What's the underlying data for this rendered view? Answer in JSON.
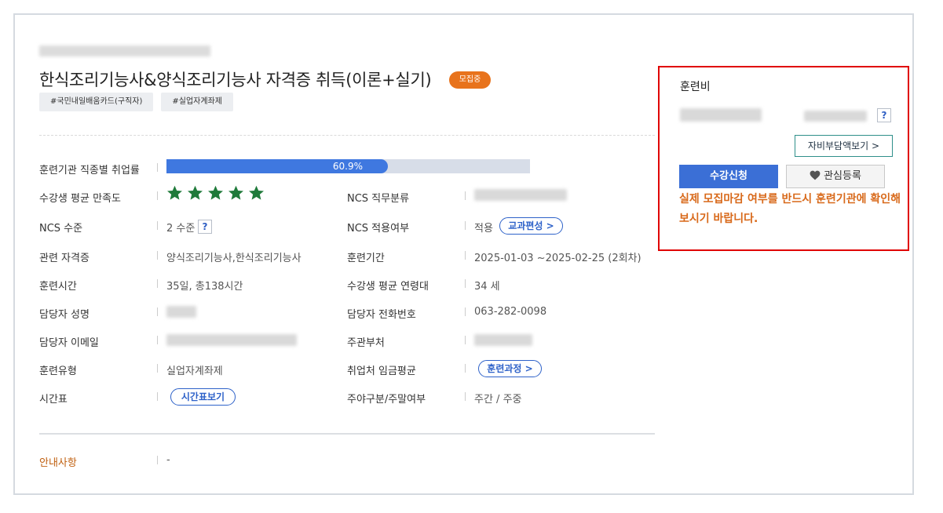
{
  "course": {
    "title": "한식조리기능사&양식조리기능사 자격증 취득(이론+실기)",
    "status_badge": "모집중",
    "tags": [
      "#국민내일배움카드(구직자)",
      "#실업자계좌제"
    ]
  },
  "info": {
    "employment_rate": {
      "label": "훈련기관 직종별 취업률",
      "value_text": "60.9%",
      "value": 0.609
    },
    "satisfaction": {
      "label": "수강생 평균 만족도",
      "stars": 5
    },
    "ncs_job": {
      "label": "NCS 직무분류"
    },
    "ncs_level": {
      "label": "NCS 수준",
      "value": "2 수준",
      "help": "?"
    },
    "ncs_applied": {
      "label": "NCS 적용여부",
      "value": "적용",
      "button": "교과편성 >"
    },
    "certificates": {
      "label": "관련 자격증",
      "value": "양식조리기능사,한식조리기능사"
    },
    "period": {
      "label": "훈련기간",
      "value": "2025-01-03 ~2025-02-25 (2회차)"
    },
    "hours": {
      "label": "훈련시간",
      "value": "35일, 총138시간"
    },
    "avg_age": {
      "label": "수강생 평균 연령대",
      "value": "34 세"
    },
    "manager_name": {
      "label": "담당자 성명"
    },
    "manager_phone": {
      "label": "담당자 전화번호",
      "value": "063-282-0098"
    },
    "manager_email": {
      "label": "담당자 이메일"
    },
    "ministry": {
      "label": "주관부처"
    },
    "training_type": {
      "label": "훈련유형",
      "value": "실업자계좌제"
    },
    "wage": {
      "label": "취업처 임금평균",
      "button": "훈련과정 >"
    },
    "timetable": {
      "label": "시간표",
      "button": "시간표보기"
    },
    "day_night": {
      "label": "주야구분/주말여부",
      "value": "주간 / 주중"
    },
    "notice": {
      "label": "안내사항",
      "value": "-"
    }
  },
  "fee_panel": {
    "title": "훈련비",
    "help": "?",
    "self_pay_button": "자비부담액보기 >",
    "apply_button": "수강신청",
    "favorite_button": "관심등록",
    "notice": "실제 모집마감 여부를 반드시 훈련기관에 확인해보시기 바랍니다."
  },
  "colors": {
    "accent": "#3b6fd6",
    "badge": "#e8731c",
    "star": "#1f7a3a",
    "notice": "#d8691a",
    "highlight_border": "#e00000"
  },
  "icons": {
    "star": "star-icon",
    "heart": "heart-icon"
  }
}
